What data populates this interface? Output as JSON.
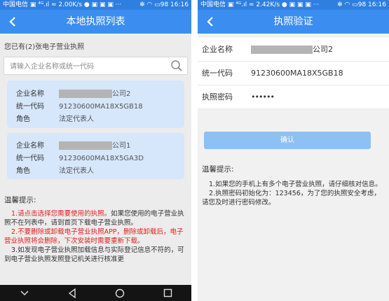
{
  "left_screen": {
    "status": {
      "left": "中国电信 ▣ ⁴ᴳ.ıl ≈ 2.00K/s ● ▣ ▣ ▣ ···",
      "right": "✻ ◠ ▭98 16:16"
    },
    "title": "本地执照列表",
    "count_text": "您已有(2)张电子营业执照",
    "search": {
      "placeholder": "请输入企业名称或统一代码"
    },
    "cards": [
      {
        "name_label": "企业名称",
        "name_suffix": "公司2",
        "code_label": "统一代码",
        "code": "91230600MA18X5GB18",
        "role_label": "角色",
        "role": "法定代表人"
      },
      {
        "name_label": "企业名称",
        "name_suffix": "公司1",
        "code_label": "统一代码",
        "code": "91230600MA18X5GA3D",
        "role_label": "角色",
        "role": "法定代表人"
      }
    ],
    "tips": {
      "heading": "温馨提示:",
      "item1_red": "1.请点击选择您需要使用的执照。",
      "item1_rest": "如果您使用的电子营业执照不在列表中，请到首页下载电子营业执照。",
      "item2": "2.不要删除或卸载电子营业执照APP，删除或卸载后，电子营业执照将会删除，下次安装时需要重新下载。",
      "item3": "3.如发现电子营业执照加载信息与实际登记信息不符的，可到电子营业执照发照登记机关进行核准更"
    }
  },
  "right_screen": {
    "status": {
      "left": "中国电信 ▣ ⁴ᴳ.ıl ≈ 2.42K/s ● ▣ ▣ ▣ ···",
      "right": "✻ ◠ ▭98 16:16"
    },
    "title": "执照验证",
    "fields": {
      "name_label": "企业名称",
      "name_suffix": "公司2",
      "code_label": "统一代码",
      "code": "91230600MA18X5GB18",
      "password_label": "执照密码",
      "password": "••••••"
    },
    "confirm_label": "确认",
    "tips": {
      "heading": "温馨提示:",
      "item1": "1.如果您的手机上有多个电子营业执照，请仔细核对信息。",
      "item2": "2.执照密码初始化为：123456，为了您的执照安全考虑，请您及时进行密码修改。"
    }
  }
}
